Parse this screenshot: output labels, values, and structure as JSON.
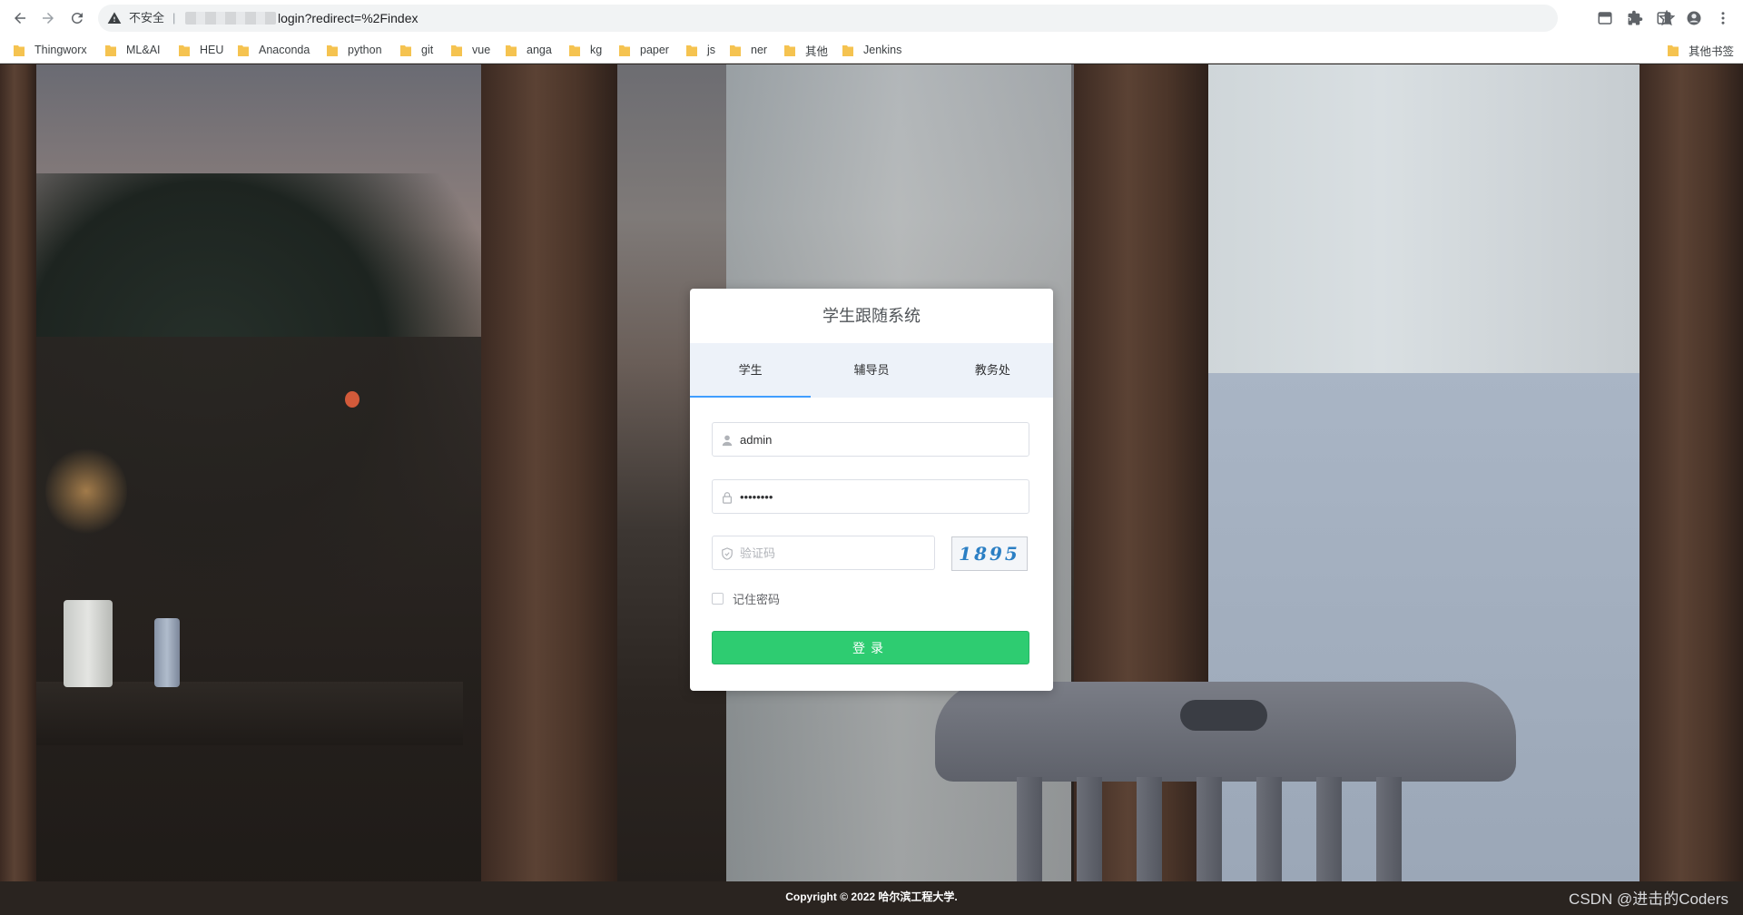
{
  "browser": {
    "security_label": "不安全",
    "separator": "|",
    "url": "login?redirect=%2Findex",
    "bookmarks": [
      {
        "label": "Thingworx"
      },
      {
        "label": "ML&AI"
      },
      {
        "label": "HEU"
      },
      {
        "label": "Anaconda"
      },
      {
        "label": "python"
      },
      {
        "label": "git"
      },
      {
        "label": "vue"
      },
      {
        "label": "anga"
      },
      {
        "label": "kg"
      },
      {
        "label": "paper"
      },
      {
        "label": "js"
      },
      {
        "label": "ner"
      },
      {
        "label": "其他"
      },
      {
        "label": "Jenkins"
      }
    ],
    "other_bookmarks": "其他书签"
  },
  "login": {
    "title": "学生跟随系统",
    "tabs": [
      {
        "label": "学生",
        "active": true
      },
      {
        "label": "辅导员",
        "active": false
      },
      {
        "label": "教务处",
        "active": false
      }
    ],
    "username": {
      "value": "admin",
      "placeholder": ""
    },
    "password": {
      "value": "••••••••",
      "placeholder": ""
    },
    "captcha": {
      "value": "",
      "placeholder": "验证码",
      "code_text": "1895"
    },
    "remember_label": "记住密码",
    "remember_checked": false,
    "submit_label": "登录"
  },
  "footer": {
    "copyright": "Copyright © 2022 哈尔滨工程大学."
  },
  "watermark": "CSDN @进击的Coders",
  "colors": {
    "tab_active_underline": "#409eff",
    "submit_button": "#2ecc71",
    "tabs_background": "#edf2f9"
  }
}
